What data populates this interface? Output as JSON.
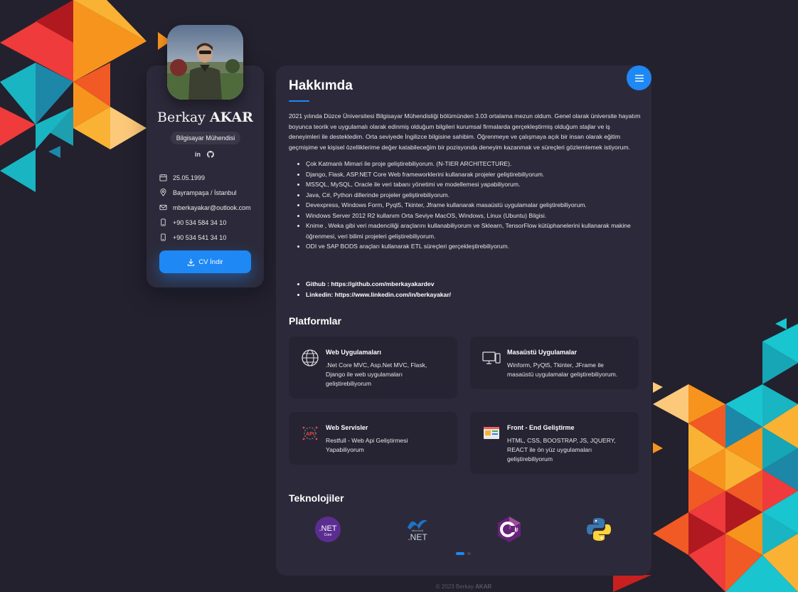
{
  "profile": {
    "first_name": "Berkay",
    "last_name": "AKAR",
    "title": "Bilgisayar Mühendisi",
    "social": [
      {
        "icon": "linkedin-icon",
        "label": "in"
      },
      {
        "icon": "github-icon",
        "label": ""
      }
    ],
    "info": [
      {
        "icon": "calendar-icon",
        "text": "25.05.1999"
      },
      {
        "icon": "location-pin-icon",
        "text": "Bayrampaşa / İstanbul"
      },
      {
        "icon": "mail-icon",
        "text": "mberkayakar@outlook.com"
      },
      {
        "icon": "phone-icon",
        "text": "+90 534 584 34 10"
      },
      {
        "icon": "phone-icon",
        "text": "+90 534 541 34 10"
      }
    ],
    "cv_button": "CV İndir"
  },
  "about": {
    "heading": "Hakkımda",
    "paragraph": "2021 yılında Düzce Üniversitesi Bilgisayar Mühendisliği bölümünden 3.03 ortalama mezun oldum. Genel olarak üniversite hayatım boyunca teorik ve uygulamalı olarak edinmiş olduğum bilgileri kurumsal firmalarda gerçekleştirmiş olduğum stajlar ve iş deneyimleri ile destekledim. Orta seviyede İngilizce bilgisine sahibim. Öğrenmeye ve çalışmaya açık bir insan olarak eğitim geçmişime ve kişisel özelliklerime değer katabileceğim bir pozisyonda deneyim kazanmak ve süreçleri gözlemlemek istiyorum.",
    "skills": [
      "Çok Katmanlı Mimari ile proje geliştirebiliyorum. (N-TIER ARCHITECTURE).",
      "Django, Flask, ASP.NET Core Web frameworklerini kullanarak projeler geliştirebiliyorum.",
      "MSSQL, MySQL, Oracle ile veri tabanı yönetimi ve modellemesi yapabiliyorum.",
      "Java, C#, Python dillerinde projeler geliştirebiliyorum.",
      "Devexpress, Windows Form, Pyqt5, Tkinter, Jframe kullanarak masaüstü uygulamalar geliştirebiliyorum.",
      "Windows Server 2012 R2 kullanım Orta Seviye MacOS, Windows, Linux (Ubuntu) Bilgisi.",
      "Knime , Weka gibi veri madenciliği araçlarını kullanabiliyorum ve Sklearn, TensorFlow kütüphanelerini kullanarak makine öğrenmesi, veri bilimi projeleri geliştirebiliyorum.",
      "ODI ve SAP BODS araçları kullanarak ETL süreçleri gerçekleştirebiliyorum."
    ],
    "links": [
      "Github : https://github.com/mberkayakardev",
      "Linkedin: https://www.linkedin.com/in/berkayakar/"
    ]
  },
  "platforms": {
    "heading": "Platformlar",
    "items": [
      {
        "icon": "globe-icon",
        "title": "Web Uygulamaları",
        "desc": ".Net Core MVC, Asp.Net MVC, Flask, Django ile web uygulamaları geliştirebiliyorum"
      },
      {
        "icon": "desktop-icon",
        "title": "Masaüstü Uygulamalar",
        "desc": "Winform, PyQt5, Tkinter, JFrame ile masaüstü uygulamalar geliştirebiliyorum."
      },
      {
        "icon": "api-icon",
        "title": "Web Servisler",
        "desc": "Restfull - Web Api Geliştirmesi Yapabiliyorum"
      },
      {
        "icon": "frontend-icon",
        "title": "Front - End Geliştirme",
        "desc": "HTML, CSS, BOOSTRAP, JS, JQUERY, REACT ile ön yüz uygulamaları geliştirebiliyorum"
      }
    ]
  },
  "technologies": {
    "heading": "Teknolojiler",
    "items": [
      {
        "icon": "dotnet-core-icon",
        "label": ".NET",
        "sub": "Core"
      },
      {
        "icon": "dotnet-framework-icon",
        "label": ".NET",
        "sub": "Microsoft"
      },
      {
        "icon": "csharp-icon",
        "label": "C#"
      },
      {
        "icon": "python-icon",
        "label": ""
      }
    ],
    "pagination": {
      "pages": 2,
      "active": 1
    }
  },
  "footer": {
    "prefix": "© 2023 Berkay",
    "name": "AKAR"
  },
  "colors": {
    "accent": "#1e88f5",
    "background": "#23212e",
    "card": "#2c2a3a"
  }
}
